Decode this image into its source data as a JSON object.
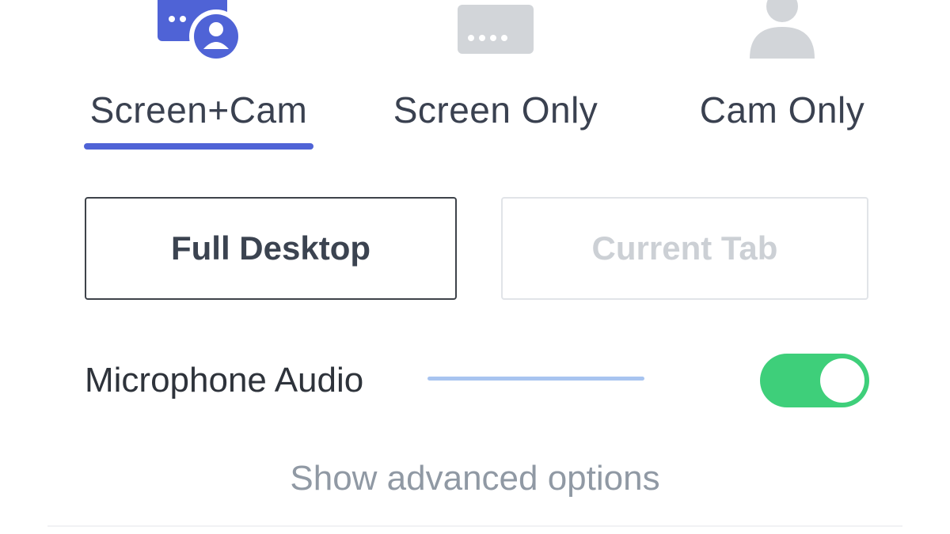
{
  "modes": {
    "screen_cam": {
      "label": "Screen+Cam",
      "icon": "screen-cam-icon",
      "selected": true
    },
    "screen_only": {
      "label": "Screen Only",
      "icon": "screen-only-icon",
      "selected": false
    },
    "cam_only": {
      "label": "Cam Only",
      "icon": "cam-only-icon",
      "selected": false
    }
  },
  "capture": {
    "full_desktop": {
      "label": "Full Desktop",
      "selected": true
    },
    "current_tab": {
      "label": "Current Tab",
      "selected": false
    }
  },
  "microphone": {
    "label": "Microphone Audio",
    "enabled": true
  },
  "advanced_link": "Show advanced options",
  "colors": {
    "accent": "#4f63d6",
    "toggle_on": "#3ecf7a",
    "mic_level": "#a8c4f0",
    "inactive_icon": "#d2d5d9"
  }
}
